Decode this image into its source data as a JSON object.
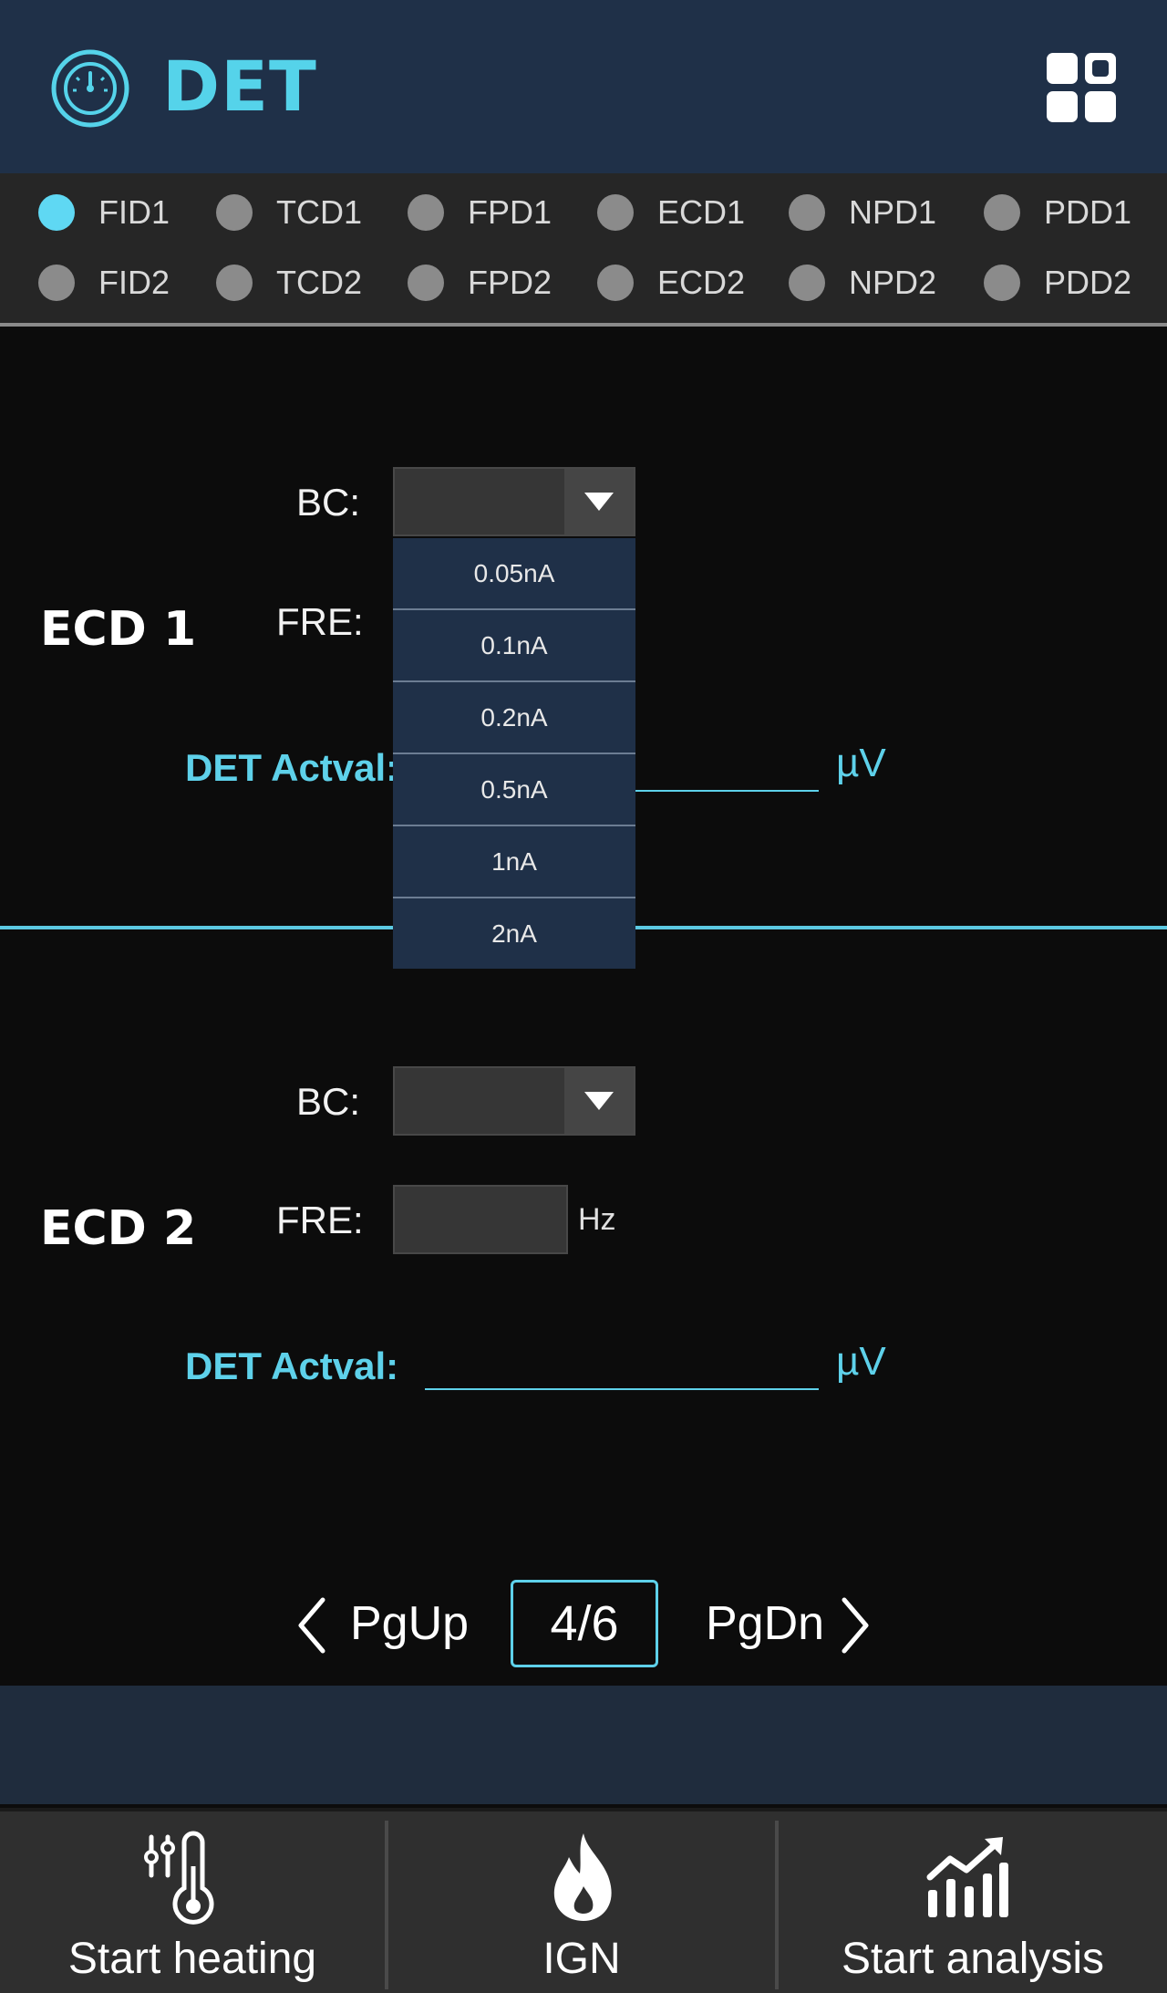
{
  "header": {
    "title": "DET",
    "logo_icon": "gauge-icon",
    "menu_icon": "grid-menu-icon",
    "accent_color": "#55d3ea",
    "background": "#1f3048"
  },
  "detectors": {
    "selected": "FID1",
    "row1": [
      "FID1",
      "TCD1",
      "FPD1",
      "ECD1",
      "NPD1",
      "PDD1"
    ],
    "row2": [
      "FID2",
      "TCD2",
      "FPD2",
      "ECD2",
      "NPD2",
      "PDD2"
    ]
  },
  "ecd1": {
    "name": "ECD 1",
    "bc_label": "BC:",
    "bc_value": "",
    "fre_label": "FRE:",
    "actval_label": "DET Actval:",
    "actval_value": "",
    "actval_unit": "µV"
  },
  "bc_dropdown": {
    "open": true,
    "options": [
      "0.05nA",
      "0.1nA",
      "0.2nA",
      "0.5nA",
      "1nA",
      "2nA"
    ]
  },
  "ecd2": {
    "name": "ECD 2",
    "bc_label": "BC:",
    "bc_value": "",
    "fre_label": "FRE:",
    "fre_value": "",
    "fre_unit": "Hz",
    "actval_label": "DET Actval:",
    "actval_value": "",
    "actval_unit": "µV"
  },
  "pager": {
    "prev_label": "PgUp",
    "page": "4/6",
    "next_label": "PgDn"
  },
  "bottom_bar": {
    "heating_label": "Start heating",
    "heating_icon": "thermometer-icon",
    "ign_label": "IGN",
    "ign_icon": "flame-icon",
    "analysis_label": "Start analysis",
    "analysis_icon": "chart-trend-icon"
  }
}
